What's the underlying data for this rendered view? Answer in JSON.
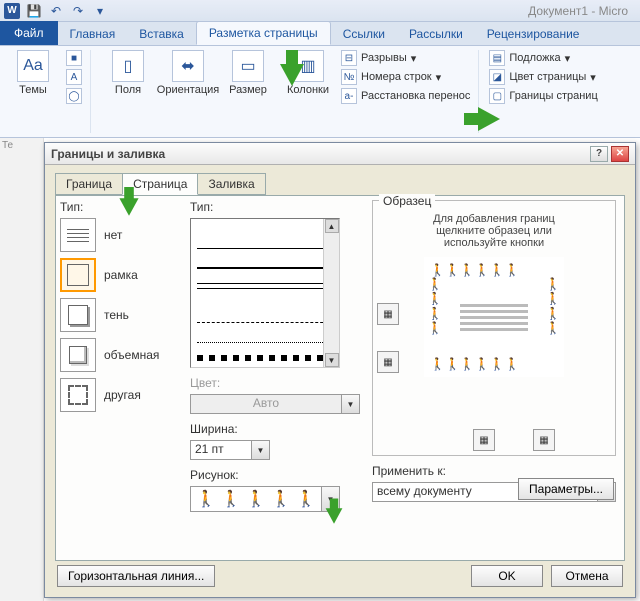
{
  "window": {
    "title": "Документ1 - Micro"
  },
  "ribbon": {
    "file": "Файл",
    "tabs": [
      "Главная",
      "Вставка",
      "Разметка страницы",
      "Ссылки",
      "Рассылки",
      "Рецензирование"
    ],
    "active_tab": 2,
    "themes_label": "Темы",
    "margins": "Поля",
    "orientation": "Ориентация",
    "size": "Размер",
    "columns": "Колонки",
    "breaks": "Разрывы",
    "line_numbers": "Номера строк",
    "hyphenation": "Расстановка перенос",
    "watermark": "Подложка",
    "page_color": "Цвет страницы",
    "page_borders": "Границы страниц"
  },
  "dialog": {
    "title": "Границы и заливка",
    "tabs": [
      "Граница",
      "Страница",
      "Заливка"
    ],
    "active_tab": 1,
    "type_label": "Тип:",
    "types": [
      "нет",
      "рамка",
      "тень",
      "объемная",
      "другая"
    ],
    "style_label": "Тип:",
    "color_label": "Цвет:",
    "color_value": "Авто",
    "width_label": "Ширина:",
    "width_value": "21 пт",
    "art_label": "Рисунок:",
    "preview_label": "Образец",
    "preview_hint1": "Для добавления границ",
    "preview_hint2": "щелкните образец или",
    "preview_hint3": "используйте кнопки",
    "apply_label": "Применить к:",
    "apply_value": "всему документу",
    "params": "Параметры...",
    "hline": "Горизонтальная линия...",
    "ok": "OK",
    "cancel": "Отмена"
  },
  "gutter": "Те"
}
